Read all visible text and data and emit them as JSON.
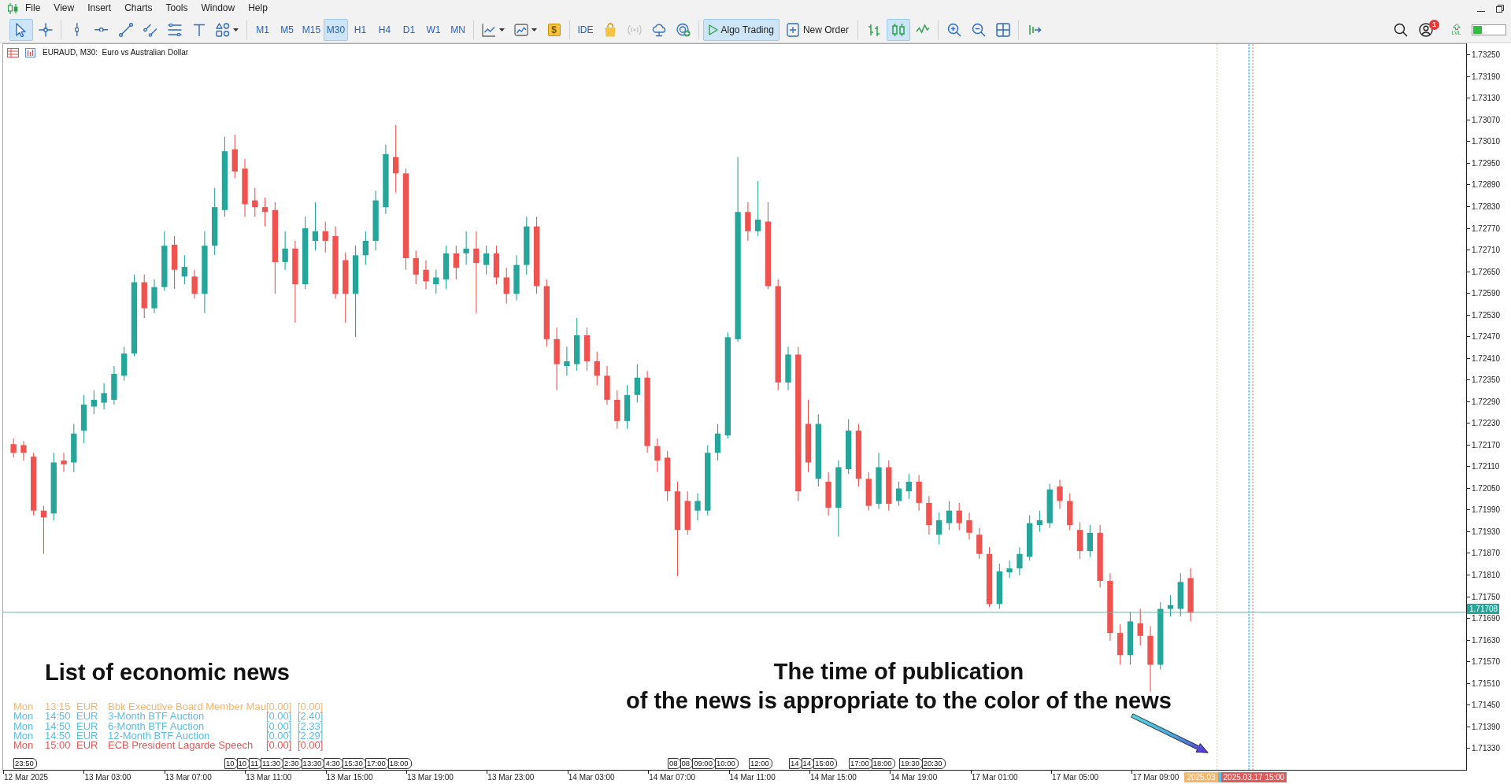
{
  "menu": [
    "File",
    "View",
    "Insert",
    "Charts",
    "Tools",
    "Window",
    "Help"
  ],
  "toolbar": {
    "drawing_tools": [
      {
        "kind": "cursor",
        "selected": true
      },
      {
        "kind": "crosshair",
        "selected": false
      },
      {
        "kind": "vline",
        "selected": false
      },
      {
        "kind": "hline",
        "selected": false
      },
      {
        "kind": "trend",
        "selected": false
      },
      {
        "kind": "channel",
        "selected": false
      },
      {
        "kind": "fibo",
        "selected": false
      },
      {
        "kind": "text",
        "selected": false
      },
      {
        "kind": "shapes",
        "selected": false
      }
    ],
    "timeframes": [
      {
        "label": "M1",
        "selected": false
      },
      {
        "label": "M5",
        "selected": false
      },
      {
        "label": "M15",
        "selected": false
      },
      {
        "label": "M30",
        "selected": true
      },
      {
        "label": "H1",
        "selected": false
      },
      {
        "label": "H4",
        "selected": false
      },
      {
        "label": "D1",
        "selected": false
      },
      {
        "label": "W1",
        "selected": false
      },
      {
        "label": "MN",
        "selected": false
      }
    ],
    "dollar_symbol": "$",
    "services": [
      {
        "kind": "ide",
        "label": "IDE",
        "disabled": false
      },
      {
        "kind": "market",
        "disabled": false
      },
      {
        "kind": "signals",
        "disabled": true
      },
      {
        "kind": "cloud",
        "disabled": false
      },
      {
        "kind": "vps",
        "disabled": false
      }
    ],
    "algo_trading": {
      "label": "Algo Trading",
      "on": true
    },
    "new_order": {
      "label": "New Order"
    },
    "chart_types": [
      {
        "kind": "bars",
        "selected": false
      },
      {
        "kind": "candles",
        "selected": true
      },
      {
        "kind": "line",
        "selected": false
      }
    ],
    "notification_badge": "1",
    "level_label": "LVL"
  },
  "chart": {
    "title": "EURAUD, M30:  Euro vs Australian Dollar",
    "price_axis": [
      "1.73250",
      "1.73190",
      "1.73130",
      "1.73070",
      "1.73010",
      "1.72950",
      "1.72890",
      "1.72830",
      "1.72770",
      "1.72710",
      "1.72650",
      "1.72590",
      "1.72530",
      "1.72470",
      "1.72410",
      "1.72350",
      "1.72290",
      "1.72230",
      "1.72170",
      "1.72110",
      "1.72050",
      "1.71990",
      "1.71930",
      "1.71870",
      "1.71810",
      "1.71750",
      "1.71690",
      "1.71630",
      "1.71570",
      "1.71510",
      "1.71450",
      "1.71390",
      "1.71330"
    ],
    "current_price": "1.71708",
    "time_axis": [
      "12 Mar 2025",
      "13 Mar 03:00",
      "13 Mar 07:00",
      "13 Mar 11:00",
      "13 Mar 15:00",
      "13 Mar 19:00",
      "13 Mar 23:00",
      "14 Mar 03:00",
      "14 Mar 07:00",
      "14 Mar 11:00",
      "14 Mar 15:00",
      "14 Mar 19:00",
      "17 Mar 01:00",
      "17 Mar 05:00",
      "17 Mar 09:00"
    ],
    "time_markers": [
      {
        "label": "2025.03",
        "color": "#f6b66c"
      },
      {
        "color": "#5cbde3"
      },
      {
        "label": "2025.03.17 15:00",
        "color": "#de5b5b"
      }
    ],
    "event_tags": [
      {
        "labels": [
          "23:50"
        ]
      },
      {
        "labels": [
          "10",
          "10",
          "11",
          "11:30",
          "2:30",
          "13:30",
          "4:30",
          "15:30"
        ]
      },
      {
        "labels": [
          "17:00",
          "18:00"
        ]
      },
      {
        "labels": [
          "08",
          "08",
          "09:00",
          "10:00"
        ]
      },
      {
        "labels": [
          "12:00"
        ]
      },
      {
        "labels": [
          "14",
          "14",
          "15:00"
        ]
      },
      {
        "labels": [
          "17:00",
          "18:00"
        ]
      },
      {
        "labels": [
          "19:30",
          "20:30"
        ]
      }
    ],
    "news": [
      {
        "day": "Mon",
        "time": "13:15",
        "currency": "EUR",
        "title": "Bbk Executive Board Member Mau",
        "values": [
          "[0.00]",
          "[0.00]"
        ],
        "color": "#f6b66c"
      },
      {
        "day": "Mon",
        "time": "14:50",
        "currency": "EUR",
        "title": "3-Month BTF Auction",
        "values": [
          "[0.00]",
          "[2.40]"
        ],
        "color": "#5cbde3"
      },
      {
        "day": "Mon",
        "time": "14:50",
        "currency": "EUR",
        "title": "6-Month BTF Auction",
        "values": [
          "[0.00]",
          "[2.33]"
        ],
        "color": "#5cbde3"
      },
      {
        "day": "Mon",
        "time": "14:50",
        "currency": "EUR",
        "title": "12-Month BTF Auction",
        "values": [
          "[0.00]",
          "[2.29]"
        ],
        "color": "#5cbde3"
      },
      {
        "day": "Mon",
        "time": "15:00",
        "currency": "EUR",
        "title": "ECB President Lagarde Speech",
        "values": [
          "[0.00]",
          "[0.00]"
        ],
        "color": "#de5b5b"
      }
    ],
    "annotations": [
      {
        "lines": [
          "List of economic news"
        ]
      },
      {
        "lines": [
          "The time of publication",
          "of the news is appropriate to the color of the news"
        ]
      }
    ]
  }
}
